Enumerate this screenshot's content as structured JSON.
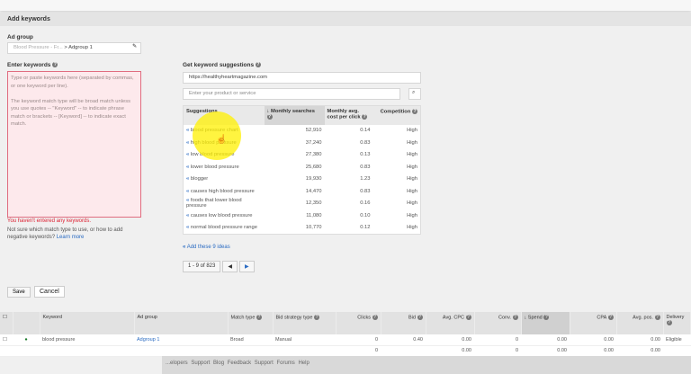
{
  "header": {
    "title": "Add keywords"
  },
  "ad_group": {
    "label": "Ad group",
    "campaign": "Blood Pressure - Fr...",
    "group": "> Adgroup 1"
  },
  "enter_keywords": {
    "label": "Enter keywords",
    "placeholder_p1": "Type or paste keywords here (separated by commas, or one keyword per line).",
    "placeholder_p2": "The keyword match type will be broad match unless you use quotes -- \"Keyword\" -- to indicate phrase match or brackets -- [Keyword] -- to indicate exact match.",
    "error": "You haven't entered any keywords.",
    "help": "Not sure which match type to use, or how to add negative keywords?",
    "learn_more": "Learn more"
  },
  "suggestions": {
    "label": "Get keyword suggestions",
    "url": "https://healthyheartmagazine.com",
    "product_placeholder": "Enter your product or service",
    "columns": [
      "Suggestions",
      "Monthly searches",
      "Monthly avg. cost per click",
      "Competition"
    ],
    "rows": [
      {
        "kw": "blood pressure chart",
        "searches": "52,910",
        "cpc": "0.14",
        "comp": "High"
      },
      {
        "kw": "high blood pressure",
        "searches": "37,240",
        "cpc": "0.83",
        "comp": "High"
      },
      {
        "kw": "low blood pressure",
        "searches": "27,380",
        "cpc": "0.13",
        "comp": "High"
      },
      {
        "kw": "lower blood pressure",
        "searches": "25,680",
        "cpc": "0.83",
        "comp": "High"
      },
      {
        "kw": "blogger",
        "searches": "19,930",
        "cpc": "1.23",
        "comp": "High"
      },
      {
        "kw": "causes high blood pressure",
        "searches": "14,470",
        "cpc": "0.83",
        "comp": "High"
      },
      {
        "kw": "foods that lower blood pressure",
        "searches": "12,350",
        "cpc": "0.16",
        "comp": "High"
      },
      {
        "kw": "causes low blood pressure",
        "searches": "11,080",
        "cpc": "0.10",
        "comp": "High"
      },
      {
        "kw": "normal blood pressure range",
        "searches": "10,770",
        "cpc": "0.12",
        "comp": "High"
      }
    ],
    "add_all": "Add these 9 ideas",
    "pagination": "1 - 9 of 823"
  },
  "actions": {
    "save": "Save",
    "cancel": "Cancel"
  },
  "kw_table": {
    "columns": [
      "Keyword",
      "Ad group",
      "Match type",
      "Bid strategy type",
      "Clicks",
      "Bid",
      "Avg. CPC",
      "Conv.",
      "Spend",
      "CPA",
      "Avg. pos.",
      "Delivery"
    ],
    "row": [
      "blood pressure",
      "Adgroup 1",
      "Broad",
      "Manual",
      "0",
      "0.40",
      "0.00",
      "0",
      "0.00",
      "0.00",
      "0.00",
      "Eligible"
    ],
    "totals": [
      "0",
      "0.00",
      "0",
      "0.00",
      "0.00",
      "0.00"
    ]
  },
  "footer": {
    "links": [
      "...elopers",
      "Support",
      "Blog",
      "Feedback",
      "Support Forums",
      "Help"
    ]
  }
}
